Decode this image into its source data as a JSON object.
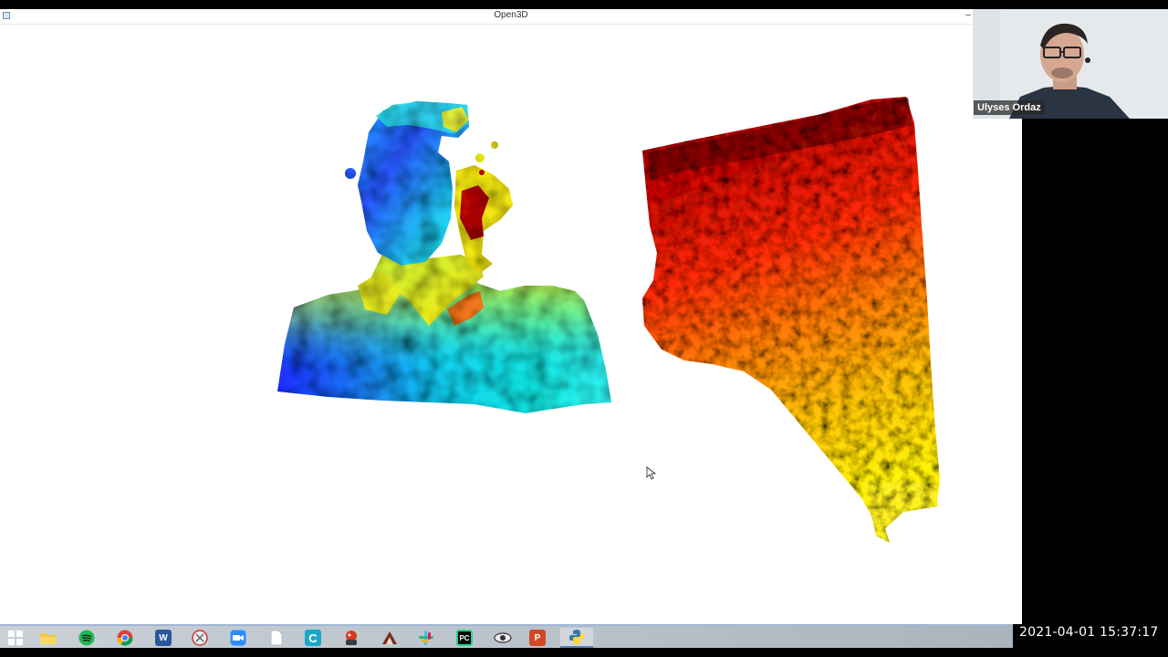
{
  "window": {
    "title": "Open3D",
    "minimize_glyph": "–"
  },
  "viewport": {
    "objects": [
      {
        "name": "point-cloud-person",
        "colormap": "jet-blue-to-red"
      },
      {
        "name": "point-cloud-surface",
        "colormap": "hot-red-to-yellow"
      }
    ],
    "colors": {
      "blue": "#1a3cff",
      "cyan": "#11d8f5",
      "yellow": "#f2ea10",
      "red": "#e21d0b",
      "dark_red": "#7a0000",
      "orange": "#ff8c0a"
    }
  },
  "video": {
    "participant_name": "Ulyses Ordaz"
  },
  "taskbar": {
    "items": [
      {
        "name": "windows-start-icon",
        "label": ""
      },
      {
        "name": "file-explorer-icon",
        "label": ""
      },
      {
        "name": "spotify-icon",
        "label": ""
      },
      {
        "name": "chrome-icon",
        "label": ""
      },
      {
        "name": "word-icon",
        "label": "W"
      },
      {
        "name": "snipping-tool-icon",
        "label": ""
      },
      {
        "name": "zoom-icon",
        "label": ""
      },
      {
        "name": "blank-document-icon",
        "label": ""
      },
      {
        "name": "ccleaner-icon",
        "label": "C"
      },
      {
        "name": "game-icon",
        "label": ""
      },
      {
        "name": "sketch-tool-icon",
        "label": ""
      },
      {
        "name": "slack-icon",
        "label": ""
      },
      {
        "name": "pycharm-icon",
        "label": "PC"
      },
      {
        "name": "eye-app-icon",
        "label": ""
      },
      {
        "name": "powerpoint-icon",
        "label": "P"
      },
      {
        "name": "python-icon",
        "label": ""
      }
    ]
  },
  "clock": {
    "datetime": "2021-04-01  15:37:17"
  }
}
